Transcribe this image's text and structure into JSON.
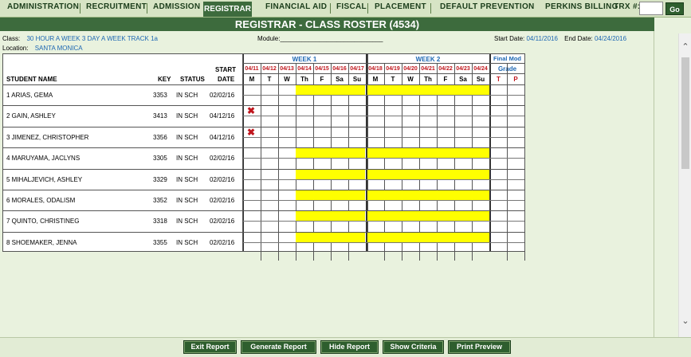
{
  "nav": {
    "tabs": [
      "ADMINISTRATION",
      "RECRUITMENT",
      "ADMISSION",
      "REGISTRAR",
      "FINANCIAL AID",
      "FISCAL",
      "PLACEMENT",
      "DEFAULT PREVENTION",
      "PERKINS BILLING"
    ],
    "trx_label": "TRX #:",
    "trx_value": "",
    "go_label": "Go"
  },
  "title": "REGISTRAR - CLASS ROSTER (4534)",
  "info": {
    "class_label": "Class:",
    "class_value": "30 HOUR A WEEK 3 DAY A WEEK   TRACK 1a",
    "location_label": "Location:",
    "location_value": "SANTA MONICA",
    "module_label": "Module:_____________________________",
    "start_label": "Start Date:",
    "start_value": "04/11/2016",
    "end_label": "End Date:",
    "end_value": "04/24/2016"
  },
  "roster": {
    "headers": {
      "student": "STUDENT NAME",
      "key": "KEY",
      "status": "STATUS",
      "start1": "START",
      "start2": "DATE"
    },
    "week1_label": "WEEK 1",
    "week2_label": "WEEK 2",
    "final_label1": "Final Mod",
    "final_label2": "Grade",
    "final_t": "T",
    "final_p": "P",
    "week1_dates": [
      "04/11",
      "04/12",
      "04/13",
      "04/14",
      "04/15",
      "04/16",
      "04/17"
    ],
    "week2_dates": [
      "04/18",
      "04/19",
      "04/20",
      "04/21",
      "04/22",
      "04/23",
      "04/24"
    ],
    "days": [
      "M",
      "T",
      "W",
      "Th",
      "F",
      "Sa",
      "Su"
    ],
    "rows": [
      {
        "name": "1  ARIAS, GEMA",
        "key": "3353",
        "status": "IN SCH",
        "start": "02/02/16",
        "mark": false
      },
      {
        "name": "2  GAIN, ASHLEY",
        "key": "3413",
        "status": "IN SCH",
        "start": "04/12/16",
        "mark": true
      },
      {
        "name": "3  JIMENEZ, CHRISTOPHER",
        "key": "3356",
        "status": "IN SCH",
        "start": "04/12/16",
        "mark": true
      },
      {
        "name": "4  MARUYAMA, JACLYNS",
        "key": "3305",
        "status": "IN SCH",
        "start": "02/02/16",
        "mark": false
      },
      {
        "name": "5  MIHALJEVICH, ASHLEY",
        "key": "3329",
        "status": "IN SCH",
        "start": "02/02/16",
        "mark": false
      },
      {
        "name": "6  MORALES, ODALISM",
        "key": "3352",
        "status": "IN SCH",
        "start": "02/02/16",
        "mark": false
      },
      {
        "name": "7  QUINTO, CHRISTINEG",
        "key": "3318",
        "status": "IN SCH",
        "start": "02/02/16",
        "mark": false
      },
      {
        "name": "8  SHOEMAKER, JENNA",
        "key": "3355",
        "status": "IN SCH",
        "start": "02/02/16",
        "mark": false
      }
    ]
  },
  "buttons": [
    "Exit Report",
    "Generate Report",
    "Hide Report",
    "Show Criteria",
    "Print Preview"
  ],
  "colors": {
    "accent": "#3d6b3d",
    "highlight": "#ffff00",
    "link": "#1d67b3",
    "date": "#c0161d"
  }
}
